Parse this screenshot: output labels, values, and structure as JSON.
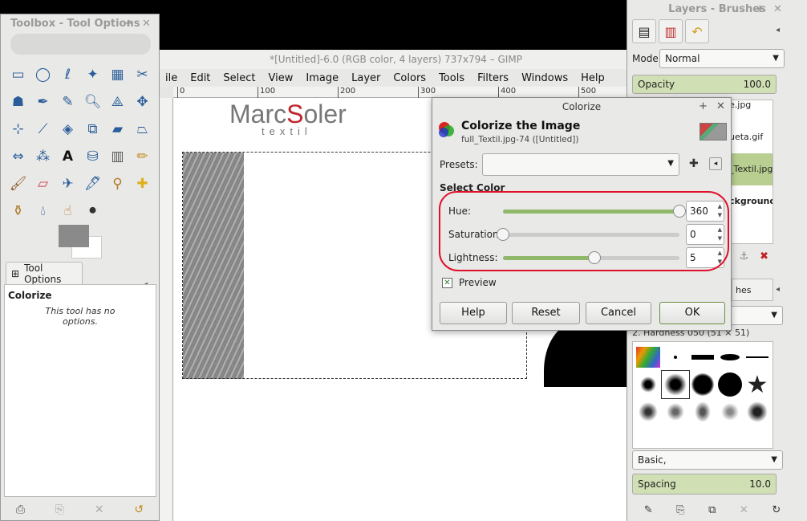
{
  "image_window": {
    "title": "*[Untitled]-6.0 (RGB color, 4 layers) 737x794 – GIMP",
    "menu": [
      "ile",
      "Edit",
      "Select",
      "View",
      "Image",
      "Layer",
      "Colors",
      "Tools",
      "Filters",
      "Windows",
      "Help"
    ],
    "ruler_ticks": [
      "0",
      "100",
      "200",
      "300",
      "400",
      "500"
    ],
    "logo_main_a": "Marc",
    "logo_s": "S",
    "logo_main_b": "oler",
    "logo_sub": "textil"
  },
  "toolbox": {
    "title": "Toolbox - Tool Options",
    "tab_label": "Tool Options",
    "panel_heading": "Colorize",
    "panel_message": "This tool has no options."
  },
  "dock": {
    "title": "Layers - Brushes",
    "mode_label": "Mode:",
    "mode_value": "Normal",
    "opacity_label": "Opacity",
    "opacity_value": "100.0",
    "layers": [
      "e.jpg",
      "ueta.gif",
      "_Textil.jpg",
      "ckground"
    ],
    "brushes_tab": "hes",
    "brush_name": "2. Hardness 050 (51 × 51)",
    "brush_set": "Basic,",
    "spacing_label": "Spacing",
    "spacing_value": "10.0"
  },
  "dialog": {
    "title": "Colorize",
    "heading": "Colorize the Image",
    "subheading": "full_Textil.jpg-74 ([Untitled])",
    "presets_label": "Presets:",
    "section": "Select Color",
    "hue_label": "Hue:",
    "hue_value": "360",
    "hue_fraction": 1.0,
    "saturation_label": "Saturation:",
    "saturation_value": "0",
    "saturation_fraction": 0.0,
    "lightness_label": "Lightness:",
    "lightness_value": "5",
    "lightness_fraction": 0.52,
    "preview_label": "Preview",
    "preview_checked": true,
    "buttons": {
      "help": "Help",
      "reset": "Reset",
      "cancel": "Cancel",
      "ok": "OK"
    }
  },
  "colors": {
    "slider_fill": "#8fb86b",
    "annotation": "#e0102a",
    "selected_layer": "#b8cf91",
    "logo_red": "#c0262c"
  }
}
